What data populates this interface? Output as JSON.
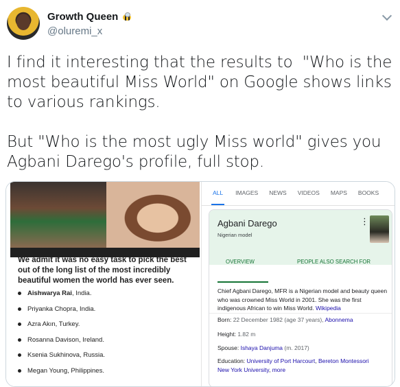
{
  "tweet": {
    "display_name": "Growth Queen",
    "handle": "@oluremi_x",
    "text": "I find it interesting that the results to  \"Who is the most beautiful Miss World\" on Google shows links to various rankings.\n\nBut \"Who is the most ugly Miss world\" gives you Agbani Darego's profile, full stop."
  },
  "left_screenshot": {
    "heading": "We admit it was no easy task to pick the best out of the long list of the most incredibly beautiful women the world has ever seen.",
    "items": [
      {
        "name": "Aishwarya Rai",
        "rest": ", India."
      },
      {
        "name": "",
        "rest": "Priyanka Chopra, India."
      },
      {
        "name": "",
        "rest": "Azra Akın, Turkey."
      },
      {
        "name": "",
        "rest": "Rosanna Davison, Ireland."
      },
      {
        "name": "",
        "rest": "Ksenia Sukhinova, Russia."
      },
      {
        "name": "",
        "rest": "Megan Young, Philippines."
      }
    ]
  },
  "right_screenshot": {
    "tabs": [
      "ALL",
      "IMAGES",
      "NEWS",
      "VIDEOS",
      "MAPS",
      "BOOKS"
    ],
    "kp": {
      "title": "Agbani Darego",
      "subtitle": "Nigerian model",
      "tab_overview": "OVERVIEW",
      "tab_people": "PEOPLE ALSO SEARCH FOR",
      "desc": "Chief Agbani Darego, MFR is a Nigerian model and beauty queen who was crowned Miss World in 2001. She was the first indigenous African to win Miss World.",
      "desc_link": "Wikipedia",
      "born_label": "Born:",
      "born_value": "22 December 1982 (age 37 years),",
      "born_link": "Abonnema",
      "height_label": "Height:",
      "height_value": "1.82 m",
      "spouse_label": "Spouse:",
      "spouse_link": "Ishaya Danjuma",
      "spouse_value": "(m. 2017)",
      "edu_label": "Education:",
      "edu_link1": "University of Port Harcourt",
      "edu_link2": "Bereton Montessori",
      "edu_link3": "New York University",
      "edu_more": "more"
    }
  }
}
